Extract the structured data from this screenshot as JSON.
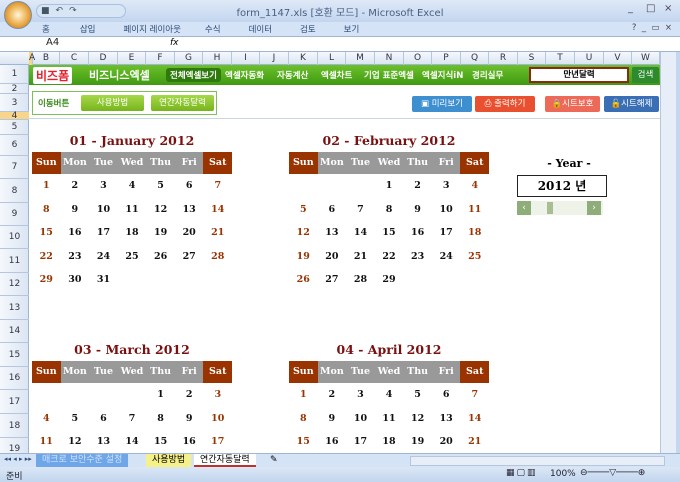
{
  "window": {
    "title": "form_1147.xls  [호환 모드] - Microsoft Excel",
    "controls": [
      "_",
      "□",
      "×"
    ]
  },
  "menus": [
    "홈",
    "삽입",
    "페이지 레이아웃",
    "수식",
    "데이터",
    "검토",
    "보기"
  ],
  "formula": {
    "name_box": "A4",
    "fx": "fx",
    "value": ""
  },
  "columns": [
    "A",
    "B",
    "C",
    "D",
    "E",
    "F",
    "G",
    "H",
    "I",
    "J",
    "K",
    "L",
    "M",
    "N",
    "O",
    "P",
    "Q",
    "R",
    "S",
    "T",
    "U",
    "V",
    "W"
  ],
  "rows": [
    "1",
    "2",
    "3",
    "4",
    "5",
    "6",
    "7",
    "8",
    "9",
    "10",
    "11",
    "12",
    "13",
    "14",
    "15",
    "16",
    "17",
    "18",
    "19"
  ],
  "brand": {
    "logo1": "비즈폼",
    "logo2": "비즈니스엑셀"
  },
  "nav": [
    "전체엑셀보기",
    "엑셀자동화",
    "자동계산",
    "엑셀차트",
    "기업 표준엑셀",
    "엑셀지식iN",
    "경리실무"
  ],
  "search": {
    "value": "만년달력",
    "button": "검색"
  },
  "move": {
    "label": "이동버튼",
    "buttons": [
      "사용방법",
      "연간자동달력"
    ]
  },
  "tools": [
    {
      "label": "미리보기",
      "color": "#3d8fd0"
    },
    {
      "label": "출력하기",
      "color": "#e8502f"
    },
    {
      "label": "시트보호",
      "color": "#ee6a58"
    },
    {
      "label": "시트해제",
      "color": "#3a6fb5"
    }
  ],
  "weekdays": [
    "Sun",
    "Mon",
    "Tue",
    "Wed",
    "Thu",
    "Fri",
    "Sat"
  ],
  "calendars": [
    {
      "title": "01 - January 2012",
      "weeks": [
        [
          "1",
          "2",
          "3",
          "4",
          "5",
          "6",
          "7"
        ],
        [
          "8",
          "9",
          "10",
          "11",
          "12",
          "13",
          "14"
        ],
        [
          "15",
          "16",
          "17",
          "18",
          "19",
          "20",
          "21"
        ],
        [
          "22",
          "23",
          "24",
          "25",
          "26",
          "27",
          "28"
        ],
        [
          "29",
          "30",
          "31",
          "",
          "",
          "",
          ""
        ]
      ]
    },
    {
      "title": "02 - February 2012",
      "weeks": [
        [
          "",
          "",
          "",
          "1",
          "2",
          "3",
          "4"
        ],
        [
          "5",
          "6",
          "7",
          "8",
          "9",
          "10",
          "11"
        ],
        [
          "12",
          "13",
          "14",
          "15",
          "16",
          "17",
          "18"
        ],
        [
          "19",
          "20",
          "21",
          "22",
          "23",
          "24",
          "25"
        ],
        [
          "26",
          "27",
          "28",
          "29",
          "",
          "",
          ""
        ]
      ]
    },
    {
      "title": "03 - March 2012",
      "weeks": [
        [
          "",
          "",
          "",
          "",
          "1",
          "2",
          "3"
        ],
        [
          "4",
          "5",
          "6",
          "7",
          "8",
          "9",
          "10"
        ],
        [
          "11",
          "12",
          "13",
          "14",
          "15",
          "16",
          "17"
        ]
      ]
    },
    {
      "title": "04 - April 2012",
      "weeks": [
        [
          "1",
          "2",
          "3",
          "4",
          "5",
          "6",
          "7"
        ],
        [
          "8",
          "9",
          "10",
          "11",
          "12",
          "13",
          "14"
        ],
        [
          "15",
          "16",
          "17",
          "18",
          "19",
          "20",
          "21"
        ]
      ]
    }
  ],
  "year": {
    "label": "- Year -",
    "value": "2012 년"
  },
  "sheet_tabs": [
    "매크로 보안수준 설정",
    "사용방법",
    "연간자동달력"
  ],
  "status": {
    "ready": "준비",
    "zoom": "100%"
  }
}
